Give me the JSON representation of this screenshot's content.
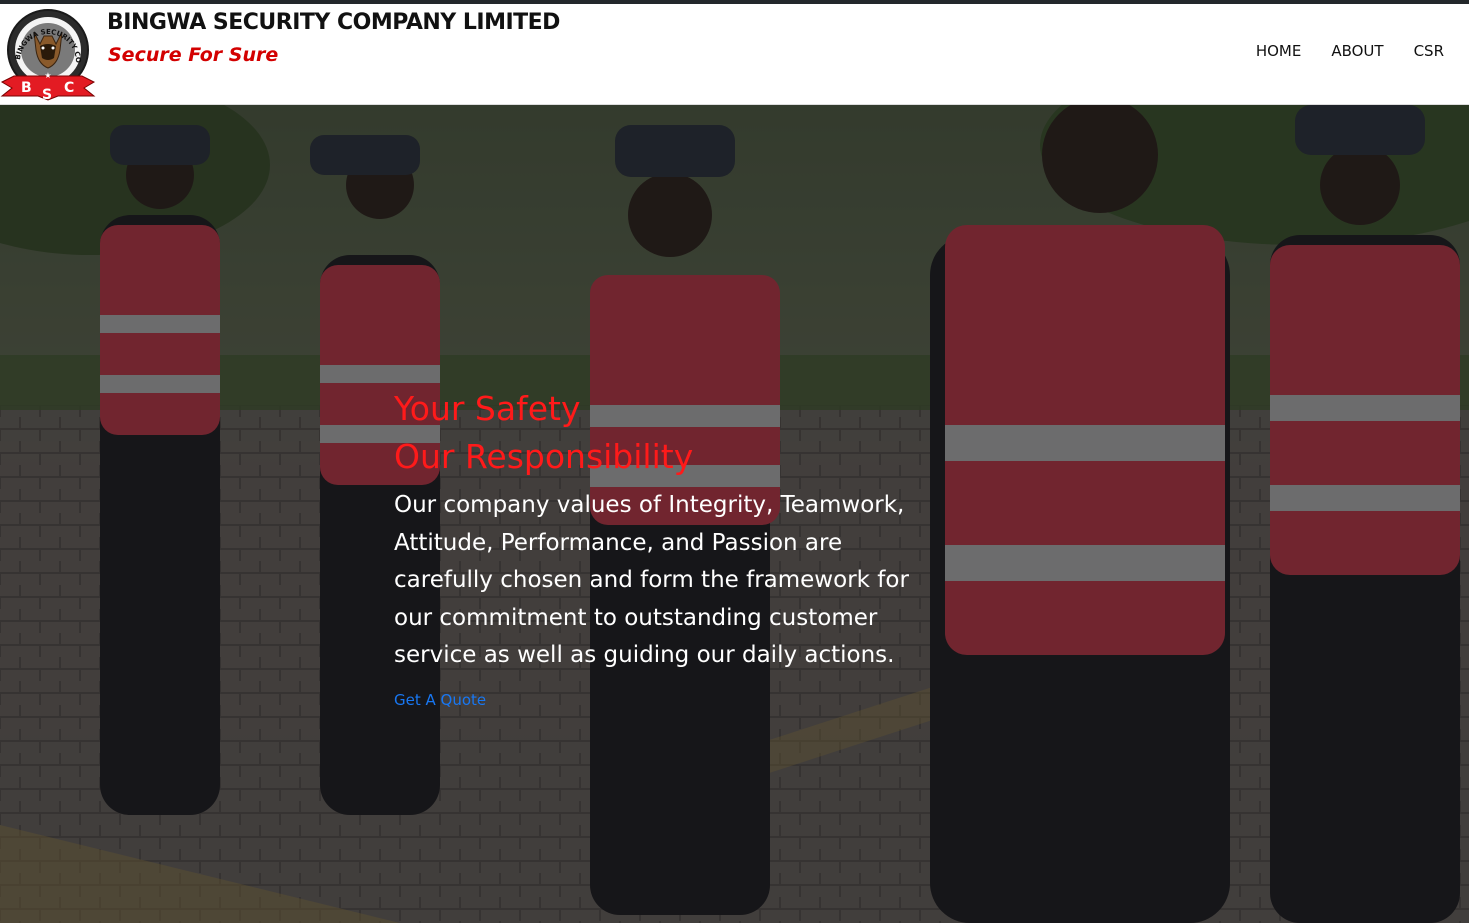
{
  "header": {
    "company_name": "BINGWA SECURITY COMPANY LIMITED",
    "tagline": "Secure For Sure",
    "logo": {
      "ring_text": "BINGWA SECURITY CO LTD",
      "letters": [
        "B",
        "S",
        "C"
      ]
    }
  },
  "nav": {
    "items": [
      "HOME",
      "ABOUT",
      "CSR"
    ]
  },
  "hero": {
    "headline_line1": "Your Safety",
    "headline_line2": "Our Responsibility",
    "body": "Our company values of Integrity, Teamwork, Attitude, Performance, and Passion are carefully chosen and form the framework for our commitment to outstanding customer service as well as guiding our daily actions.",
    "cta_label": "Get A Quote"
  },
  "colors": {
    "brand_red": "#d30000",
    "headline_red": "#ff1a1a",
    "link_blue": "#1877f2",
    "top_bar": "#23272b"
  }
}
